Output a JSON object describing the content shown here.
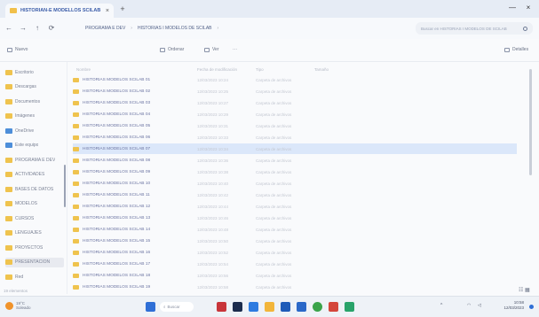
{
  "window": {
    "tab_title": "HISTORIAN-E MODELLOS SCILAB",
    "tab_close": "×",
    "new_tab": "+",
    "minimize": "—",
    "close": "×"
  },
  "address": {
    "back": "←",
    "forward": "→",
    "up": "↑",
    "refresh": "⟳",
    "crumbs": [
      "PROGRAMA E DEV",
      "HISTORIAS I MODELOS DE SCILAB",
      ""
    ],
    "separator": "›",
    "search_placeholder": "Buscar en HISTORIAS I MODELOS DE SCILAB"
  },
  "commands": {
    "new_label": "Nuevo",
    "sort_label": "Ordenar",
    "view_label": "Ver",
    "more_label": "···",
    "preview_label": "Detalles"
  },
  "columns": {
    "name": "Nombre",
    "date": "Fecha de modificación",
    "type": "Tipo",
    "size": "Tamaño"
  },
  "nav": {
    "items": [
      {
        "label": "Escritorio",
        "kind": "folder"
      },
      {
        "label": "Descargas",
        "kind": "folder"
      },
      {
        "label": "Documentos",
        "kind": "folder"
      },
      {
        "label": "Imágenes",
        "kind": "folder"
      },
      {
        "label": "OneDrive",
        "kind": "drive"
      },
      {
        "label": "Este equipo",
        "kind": "drive"
      },
      {
        "label": "PROGRAMA E DEV",
        "kind": "folder"
      },
      {
        "label": "ACTIVIDADES",
        "kind": "folder"
      },
      {
        "label": "BASES DE DATOS",
        "kind": "folder"
      },
      {
        "label": "MODELOS",
        "kind": "folder"
      },
      {
        "label": "CURSOS",
        "kind": "folder"
      },
      {
        "label": "LENGUAJES",
        "kind": "folder"
      },
      {
        "label": "PROYECTOS",
        "kind": "folder"
      },
      {
        "label": "PRESENTACION",
        "kind": "folder"
      },
      {
        "label": "Red",
        "kind": "folder"
      }
    ]
  },
  "files": [
    {
      "name": "HISTORIAS MODELOS SCILAB 01",
      "date": "12/03/2023 10:24",
      "type": "Carpeta de archivos"
    },
    {
      "name": "HISTORIAS MODELOS SCILAB 02",
      "date": "12/03/2023 10:25",
      "type": "Carpeta de archivos"
    },
    {
      "name": "HISTORIAS MODELOS SCILAB 03",
      "date": "12/03/2023 10:27",
      "type": "Carpeta de archivos"
    },
    {
      "name": "HISTORIAS MODELOS SCILAB 04",
      "date": "12/03/2023 10:29",
      "type": "Carpeta de archivos"
    },
    {
      "name": "HISTORIAS MODELOS SCILAB 05",
      "date": "12/03/2023 10:31",
      "type": "Carpeta de archivos"
    },
    {
      "name": "HISTORIAS MODELOS SCILAB 06",
      "date": "12/03/2023 10:33",
      "type": "Carpeta de archivos"
    },
    {
      "name": "HISTORIAS MODELOS SCILAB 07",
      "date": "12/03/2023 10:34",
      "type": "Carpeta de archivos"
    },
    {
      "name": "HISTORIAS MODELOS SCILAB 08",
      "date": "12/03/2023 10:36",
      "type": "Carpeta de archivos"
    },
    {
      "name": "HISTORIAS MODELOS SCILAB 09",
      "date": "12/03/2023 10:38",
      "type": "Carpeta de archivos"
    },
    {
      "name": "HISTORIAS MODELOS SCILAB 10",
      "date": "12/03/2023 10:40",
      "type": "Carpeta de archivos"
    },
    {
      "name": "HISTORIAS MODELOS SCILAB 11",
      "date": "12/03/2023 10:42",
      "type": "Carpeta de archivos"
    },
    {
      "name": "HISTORIAS MODELOS SCILAB 12",
      "date": "12/03/2023 10:44",
      "type": "Carpeta de archivos"
    },
    {
      "name": "HISTORIAS MODELOS SCILAB 13",
      "date": "12/03/2023 10:46",
      "type": "Carpeta de archivos"
    },
    {
      "name": "HISTORIAS MODELOS SCILAB 14",
      "date": "12/03/2023 10:48",
      "type": "Carpeta de archivos"
    },
    {
      "name": "HISTORIAS MODELOS SCILAB 15",
      "date": "12/03/2023 10:50",
      "type": "Carpeta de archivos"
    },
    {
      "name": "HISTORIAS MODELOS SCILAB 16",
      "date": "12/03/2023 10:52",
      "type": "Carpeta de archivos"
    },
    {
      "name": "HISTORIAS MODELOS SCILAB 17",
      "date": "12/03/2023 10:54",
      "type": "Carpeta de archivos"
    },
    {
      "name": "HISTORIAS MODELOS SCILAB 18",
      "date": "12/03/2023 10:56",
      "type": "Carpeta de archivos"
    },
    {
      "name": "HISTORIAS MODELOS SCILAB 19",
      "date": "12/03/2023 10:58",
      "type": "Carpeta de archivos"
    }
  ],
  "selected_index": 6,
  "status": {
    "text": "19 elementos"
  },
  "taskbar": {
    "weather_temp": "19°C",
    "weather_desc": "Soleado",
    "search_label": "Buscar",
    "tray_up": "^",
    "tray_wifi": "◠",
    "tray_sound": "◁",
    "time": "10:58",
    "date": "12/03/2023"
  },
  "colors": {
    "accent": "#3a5ca8",
    "folder": "#efc34e",
    "selected_row": "#dbe7fa"
  }
}
